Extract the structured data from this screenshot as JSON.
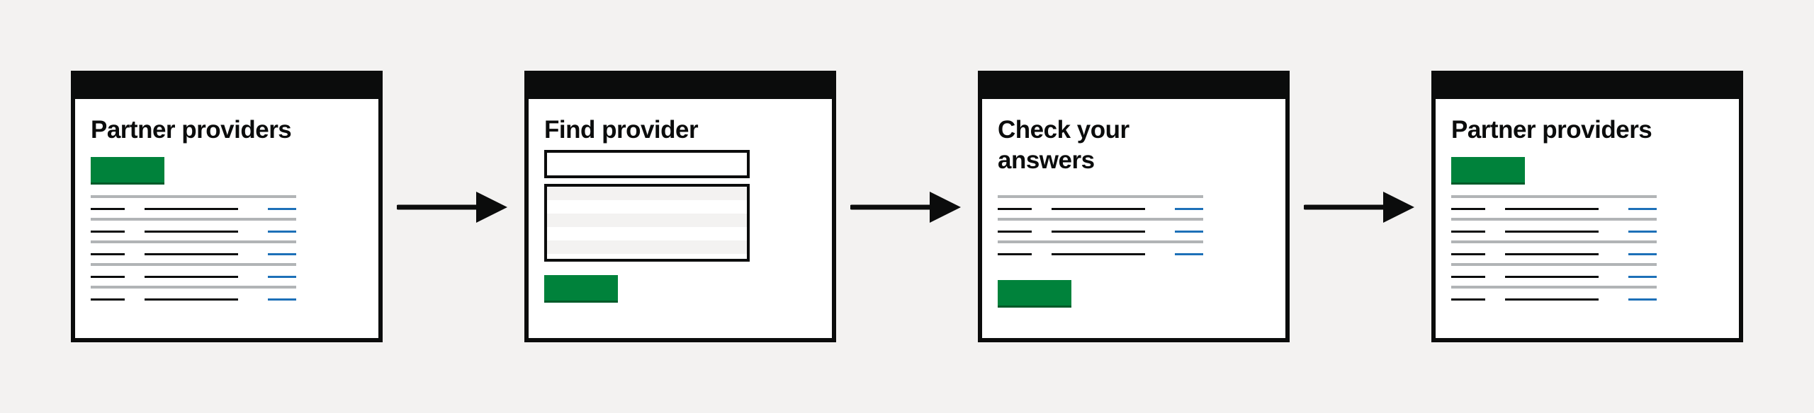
{
  "diagram": {
    "background_color": "#f3f2f1",
    "screens": [
      {
        "title": "Partner providers",
        "type": "list-page"
      },
      {
        "title": "Find provider",
        "type": "search-page"
      },
      {
        "title": "Check your answers",
        "type": "check-answers-page"
      },
      {
        "title": "Partner providers",
        "type": "list-page"
      }
    ],
    "colors": {
      "frame": "#0b0c0c",
      "button": "#00823b",
      "link": "#1d70b8",
      "divider": "#b1b4b6"
    }
  }
}
